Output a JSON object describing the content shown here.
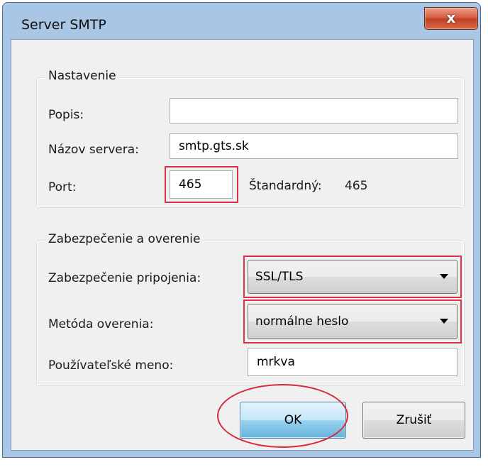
{
  "window": {
    "title": "Server SMTP",
    "close_icon": "close-icon",
    "close_glyph": "x"
  },
  "settings": {
    "legend": "Nastavenie",
    "description_label": "Popis:",
    "description_value": "",
    "server_label": "Názov servera:",
    "server_value": "smtp.gts.sk",
    "port_label": "Port:",
    "port_value": "465",
    "default_label": "Štandardný:",
    "default_value": "465"
  },
  "security": {
    "legend": "Zabezpečenie a overenie",
    "connection_label": "Zabezpečenie pripojenia:",
    "connection_value": "SSL/TLS",
    "auth_label": "Metóda overenia:",
    "auth_value": "normálne heslo",
    "username_label": "Používateľské meno:",
    "username_value": "mrkva"
  },
  "buttons": {
    "ok": "OK",
    "cancel": "Zrušiť"
  },
  "colors": {
    "highlight": "#e0324a",
    "ok_accent": "#3c7fb1",
    "close_red": "#c03f22"
  }
}
